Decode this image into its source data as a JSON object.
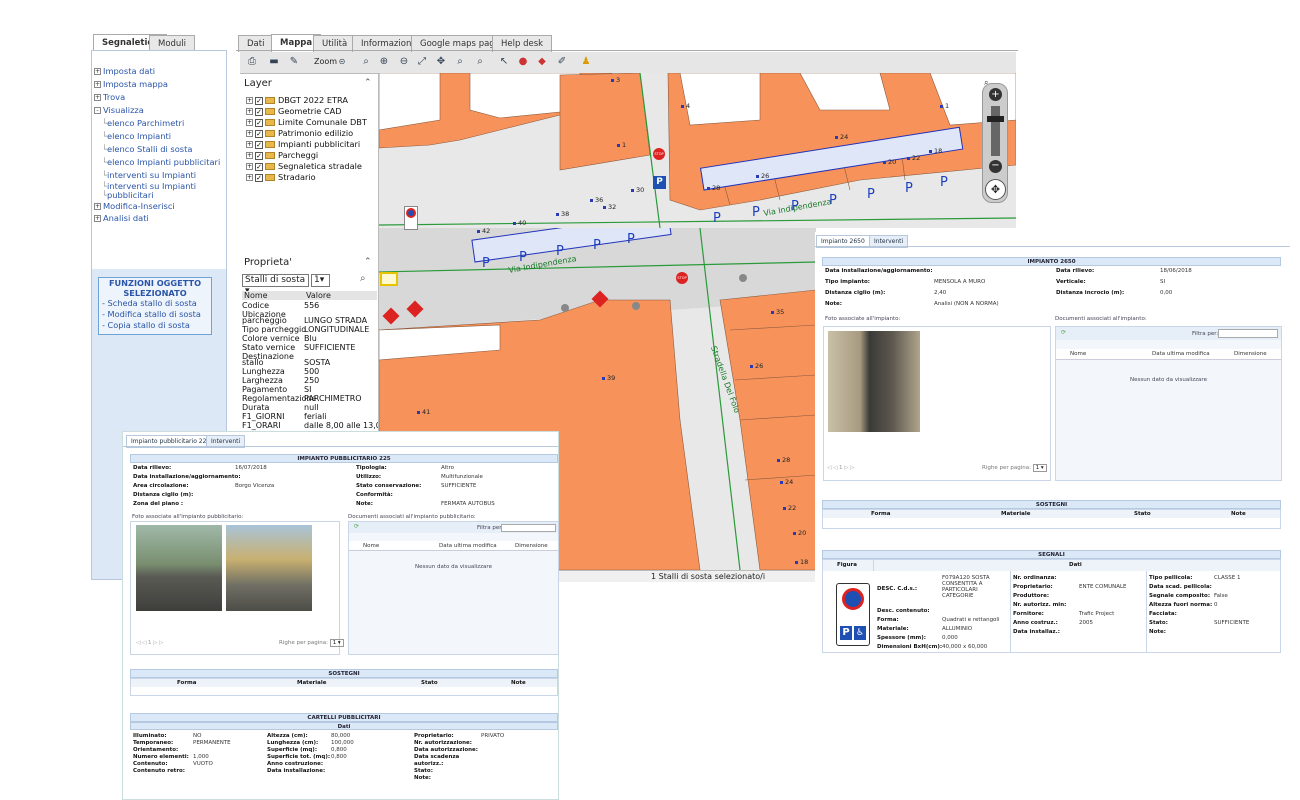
{
  "left": {
    "tabs": [
      "Segnaletica",
      "Moduli"
    ],
    "tree": [
      {
        "label": "Imposta dati",
        "pm": "+"
      },
      {
        "label": "Imposta mappa",
        "pm": "+"
      },
      {
        "label": "Trova",
        "pm": "+"
      },
      {
        "label": "Visualizza",
        "pm": "-"
      },
      {
        "label": "elenco Parchimetri",
        "pm": ""
      },
      {
        "label": "elenco Impianti",
        "pm": ""
      },
      {
        "label": "elenco Stalli di sosta",
        "pm": ""
      },
      {
        "label": "elenco Impianti pubblicitari",
        "pm": ""
      },
      {
        "label": "interventi su Impianti",
        "pm": ""
      },
      {
        "label": "interventi su Impianti",
        "pm": ""
      },
      {
        "label": "pubblicitari",
        "pm": ""
      },
      {
        "label": "Modifica-Inserisci",
        "pm": "+"
      },
      {
        "label": "Analisi dati",
        "pm": "+"
      }
    ],
    "functions": {
      "title1": "FUNZIONI OGGETTO",
      "title2": "SELEZIONATO",
      "items": [
        "- Scheda stallo di sosta",
        "- Modifica stallo di sosta",
        "- Copia stallo di sosta"
      ]
    }
  },
  "main_tabs": [
    "Dati",
    "Mappa",
    "Utilità",
    "Informazioni",
    "Google maps page",
    "Help desk"
  ],
  "toolbar": {
    "zoom_label": "Zoom"
  },
  "layers": {
    "title": "Layer",
    "items": [
      "DBGT 2022 ETRA",
      "Geometrie CAD",
      "Limite Comunale DBT",
      "Patrimonio edilizio",
      "Impianti pubblicitari",
      "Parcheggi",
      "Segnaletica stradale",
      "Stradario"
    ]
  },
  "properties": {
    "title": "Proprieta'",
    "select_value": "Stalli di sosta",
    "select_num": "1",
    "col_name": "Nome",
    "col_value": "Valore",
    "rows": [
      {
        "n": "Codice",
        "v": "556"
      },
      {
        "n": "Ubicazione",
        "v": ""
      },
      {
        "n": "parcheggio",
        "v": "LUNGO STRADA"
      },
      {
        "n": "Tipo parcheggio",
        "v": "LONGITUDINALE"
      },
      {
        "n": "Colore vernice",
        "v": "Blu"
      },
      {
        "n": "Stato vernice",
        "v": "SUFFICIENTE"
      },
      {
        "n": "Destinazione",
        "v": ""
      },
      {
        "n": "stallo",
        "v": "SOSTA"
      },
      {
        "n": "Lunghezza",
        "v": "500"
      },
      {
        "n": "Larghezza",
        "v": "250"
      },
      {
        "n": "Pagamento",
        "v": "SI"
      },
      {
        "n": "Regolamentazione",
        "v": "PARCHIMETRO"
      },
      {
        "n": "Durata",
        "v": "null"
      },
      {
        "n": "F1_GIORNI",
        "v": "feriali"
      },
      {
        "n": "F1_ORARI",
        "v": "dalle 8,00 alle 13,00"
      }
    ]
  },
  "map": {
    "status": "1 Stalli di sosta selezionato/i",
    "street1": "Via Indipendenza",
    "street2": "Via Indipendenza",
    "street3": "Stradella Del Folo",
    "numbers": [
      "3",
      "4",
      "1",
      "24",
      "20",
      "22",
      "18",
      "1",
      "28",
      "26",
      "36",
      "30",
      "40",
      "38",
      "42",
      "32",
      "35",
      "39",
      "26",
      "41",
      "28",
      "24",
      "22",
      "20",
      "18"
    ]
  },
  "card1": {
    "tabs": [
      "Impianto pubblicitario 225",
      "Interventi"
    ],
    "title": "IMPIANTO PUBBLICITARIO 225",
    "fields_left": [
      {
        "l": "Data rilievo:",
        "v": "16/07/2018"
      },
      {
        "l": "Data installazione/aggiornamento:",
        "v": ""
      },
      {
        "l": "Area circolazione:",
        "v": "Borgo Vicenza"
      },
      {
        "l": "Distanza ciglio (m):",
        "v": ""
      },
      {
        "l": "Zona del piano :",
        "v": ""
      }
    ],
    "fields_right": [
      {
        "l": "Tipologia:",
        "v": "Altro"
      },
      {
        "l": "Utilizzo:",
        "v": "Multifunzionale"
      },
      {
        "l": "Stato conservazione:",
        "v": "SUFFICIENTE"
      },
      {
        "l": "Conformità:",
        "v": ""
      },
      {
        "l": "Note:",
        "v": "FERMATA AUTOBUS"
      }
    ],
    "foto_label": "Foto associate all'impianto pubblicitario:",
    "doc_label": "Documenti associati all'impianto pubblicitario:",
    "filter_label": "Filtra per:",
    "doc_cols": [
      "Nome",
      "Data ultima modifica",
      "Dimensione"
    ],
    "nodata": "Nessun dato da visualizzare",
    "pager_label": "Righe per pagina:",
    "pager_value": "1",
    "page_num": "1",
    "sostegni_title": "SOSTEGNI",
    "sostegni_cols": [
      "Forma",
      "Materiale",
      "Stato",
      "Note"
    ],
    "cartelli_title": "CARTELLI PUBBLICITARI",
    "dati": "Dati",
    "cartelli_col1": [
      {
        "l": "Illuminato:",
        "v": "NO"
      },
      {
        "l": "Temporaneo:",
        "v": "PERMANENTE"
      },
      {
        "l": "Orientamento:",
        "v": ""
      },
      {
        "l": "Numero elementi:",
        "v": "1,000"
      },
      {
        "l": "Contenuto:",
        "v": "VUOTO"
      },
      {
        "l": "Contenuto retro:",
        "v": ""
      }
    ],
    "cartelli_col2": [
      {
        "l": "Altezza (cm):",
        "v": "80,000"
      },
      {
        "l": "Lunghezza (cm):",
        "v": "100,000"
      },
      {
        "l": "Superficie (mq):",
        "v": "0,800"
      },
      {
        "l": "Superficie tot. (mq):",
        "v": "0,800"
      },
      {
        "l": "Anno costruzione:",
        "v": ""
      },
      {
        "l": "Data installazione:",
        "v": ""
      }
    ],
    "cartelli_col3": [
      {
        "l": "Proprietario:",
        "v": "PRIVATO"
      },
      {
        "l": "Nr. autorizzazione:",
        "v": ""
      },
      {
        "l": "Data autorizzazione:",
        "v": ""
      },
      {
        "l": "Data scadenza",
        "v": ""
      },
      {
        "l": "autorizz.:",
        "v": ""
      },
      {
        "l": "Stato:",
        "v": ""
      },
      {
        "l": "Note:",
        "v": ""
      }
    ]
  },
  "card2": {
    "tabs": [
      "Impianto 2650",
      "Interventi"
    ],
    "title": "IMPIANTO 2650",
    "fields_left": [
      {
        "l": "Data installazione/aggiornamento:",
        "v": ""
      },
      {
        "l": "Tipo impianto:",
        "v": "MENSOLA A MURO"
      },
      {
        "l": "Distanza ciglio (m):",
        "v": "2,40"
      },
      {
        "l": "Note:",
        "v": "Analisi (NON A NORMA)"
      }
    ],
    "fields_right": [
      {
        "l": "Data rilievo:",
        "v": "18/06/2018"
      },
      {
        "l": "Verticale:",
        "v": "SI"
      },
      {
        "l": "Distanza incrocio (m):",
        "v": "0,00"
      }
    ],
    "foto_label": "Foto associate all'impianto:",
    "doc_label": "Documenti associati all'impianto:",
    "filter_label": "Filtra per:",
    "doc_cols": [
      "Nome",
      "Data ultima modifica",
      "Dimensione"
    ],
    "nodata": "Nessun dato da visualizzare",
    "pager_label": "Righe per pagina:",
    "pager_value": "1",
    "page_num": "1",
    "sostegni_title": "SOSTEGNI",
    "sostegni_cols": [
      "Forma",
      "Materiale",
      "Stato",
      "Note"
    ],
    "segnali_title": "SEGNALI",
    "figura": "Figura",
    "dati": "Dati",
    "seg_col1": [
      {
        "l": "DESC. C.d.s.:",
        "v": "F079A120 SOSTA CONSENTITA A PARTICOLARI CATEGORIE"
      },
      {
        "l": "Desc. contenuto:",
        "v": ""
      },
      {
        "l": "Forma:",
        "v": "Quadrati e rettangoli"
      },
      {
        "l": "Materiale:",
        "v": "ALLUMINIO"
      },
      {
        "l": "Spessore (mm):",
        "v": "0,000"
      },
      {
        "l": "Dimensioni BxH(cm):",
        "v": "40,000 x 60,000"
      }
    ],
    "seg_col2": [
      {
        "l": "Nr. ordinanza:",
        "v": ""
      },
      {
        "l": "Proprietario:",
        "v": "ENTE COMUNALE"
      },
      {
        "l": "Produttore:",
        "v": ""
      },
      {
        "l": "Nr. autorizz. min:",
        "v": ""
      },
      {
        "l": "Fornitore:",
        "v": "Trafic Project"
      },
      {
        "l": "Anno costruz.:",
        "v": "2005"
      },
      {
        "l": "Data installaz.:",
        "v": ""
      }
    ],
    "seg_col3": [
      {
        "l": "Tipo pellicola:",
        "v": "CLASSE 1"
      },
      {
        "l": "Data scad. pellicola:",
        "v": ""
      },
      {
        "l": "Segnale composito:",
        "v": "False"
      },
      {
        "l": "Altezza fuori norma:",
        "v": "0"
      },
      {
        "l": "Facciata:",
        "v": ""
      },
      {
        "l": "Stato:",
        "v": "SUFFICIENTE"
      },
      {
        "l": "Note:",
        "v": ""
      }
    ]
  }
}
